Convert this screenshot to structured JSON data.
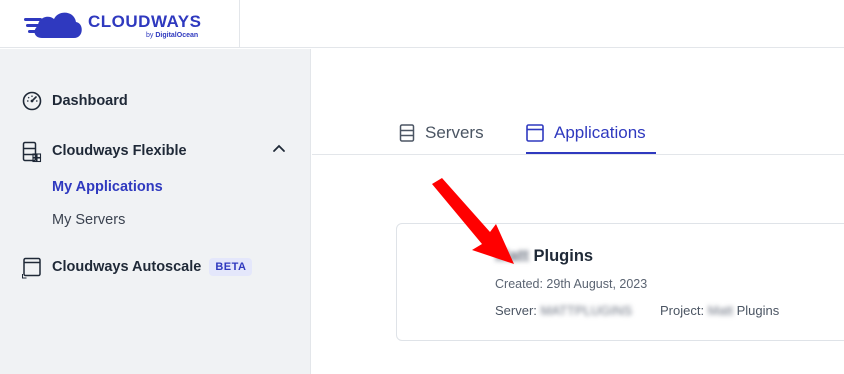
{
  "brand": {
    "name": "CLOUDWAYS",
    "by": "by",
    "by_company": "DigitalOcean",
    "color": "#2f39bf"
  },
  "sidebar": {
    "dashboard": {
      "label": "Dashboard",
      "icon": "speedometer-icon"
    },
    "flexible": {
      "label": "Cloudways Flexible",
      "icon": "server-stack-icon",
      "expanded": true,
      "children": [
        {
          "label": "My Applications",
          "active": true
        },
        {
          "label": "My Servers",
          "active": false
        }
      ]
    },
    "autoscale": {
      "label": "Cloudways Autoscale",
      "icon": "window-icon",
      "badge": "BETA"
    }
  },
  "tabs": [
    {
      "label": "Servers",
      "icon": "server-icon",
      "active": false
    },
    {
      "label": "Applications",
      "icon": "window-icon",
      "active": true
    }
  ],
  "app_card": {
    "name_prefix": "Matt",
    "name_suffix": " Plugins",
    "created": "Created: 29th August, 2023",
    "server_label": "Server:",
    "server_value": "MATTPLUGINS",
    "project_label": "Project:",
    "project_value_prefix": "Matt",
    "project_value_suffix": " Plugins"
  }
}
